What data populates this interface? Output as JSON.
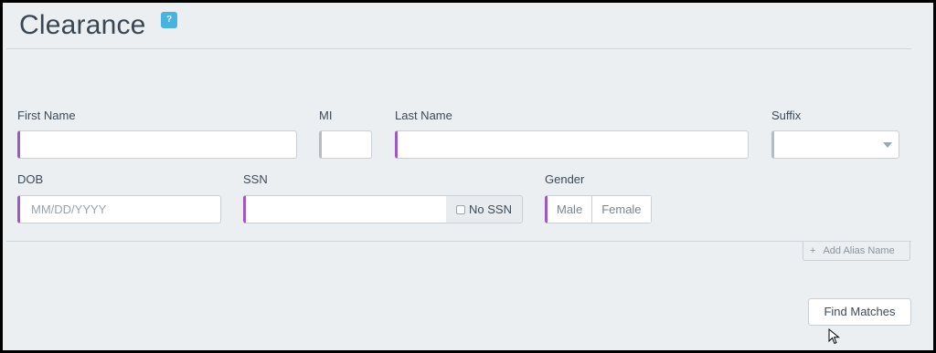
{
  "page": {
    "title": "Clearance",
    "help_icon_glyph": "?"
  },
  "form": {
    "first_name": {
      "label": "First Name",
      "value": ""
    },
    "mi": {
      "label": "MI",
      "value": ""
    },
    "last_name": {
      "label": "Last Name",
      "value": ""
    },
    "suffix": {
      "label": "Suffix",
      "value": ""
    },
    "dob": {
      "label": "DOB",
      "placeholder": "MM/DD/YYYY",
      "value": ""
    },
    "ssn": {
      "label": "SSN",
      "value": "",
      "no_ssn_label": "No SSN",
      "no_ssn_checked": false
    },
    "gender": {
      "label": "Gender",
      "options": [
        "Male",
        "Female"
      ]
    }
  },
  "actions": {
    "add_alias_plus": "+",
    "add_alias_label": "Add Alias Name",
    "find_matches_label": "Find Matches"
  },
  "colors": {
    "required_accent": "#9b59c7",
    "help_icon": "#46b3e0",
    "background": "#eceff1"
  }
}
